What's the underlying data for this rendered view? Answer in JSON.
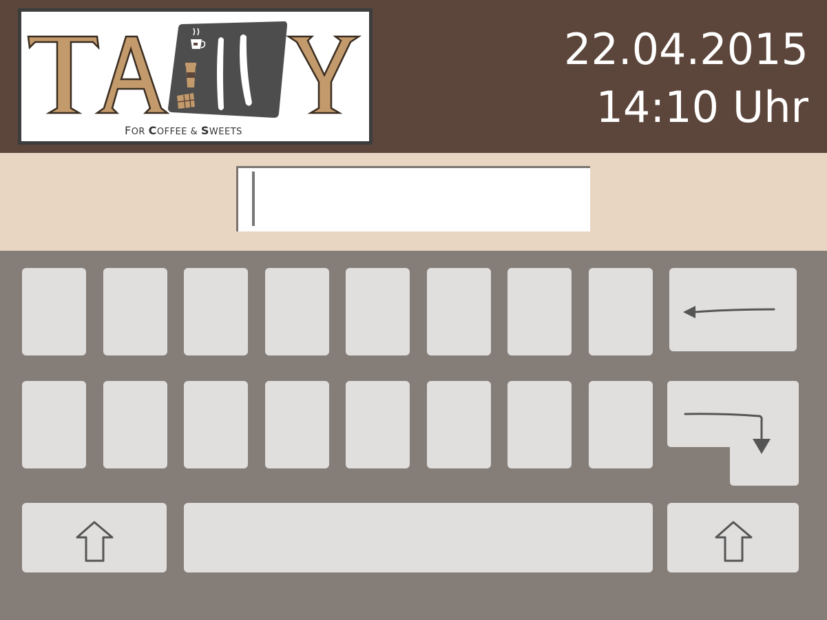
{
  "app": {
    "logo": {
      "wordmark": "TALLY",
      "tagline": "For Coffee & Sweets"
    }
  },
  "header": {
    "date": "22.04.2015",
    "time": "14:10 Uhr"
  },
  "input": {
    "value": ""
  },
  "keyboard": {
    "row1_letter_keys": [
      "",
      "",
      "",
      "",
      "",
      "",
      "",
      ""
    ],
    "row2_letter_keys": [
      "",
      "",
      "",
      "",
      "",
      "",
      "",
      ""
    ],
    "icons": {
      "backspace": "backspace-arrow-icon",
      "enter": "enter-arrow-icon",
      "shift": "shift-arrow-icon"
    }
  },
  "colors": {
    "header_bg": "#5c463b",
    "input_band_bg": "#e8d6c3",
    "keyboard_bg": "#857d77",
    "key_bg": "#e0dfde",
    "logo_accent": "#c39a6b"
  }
}
